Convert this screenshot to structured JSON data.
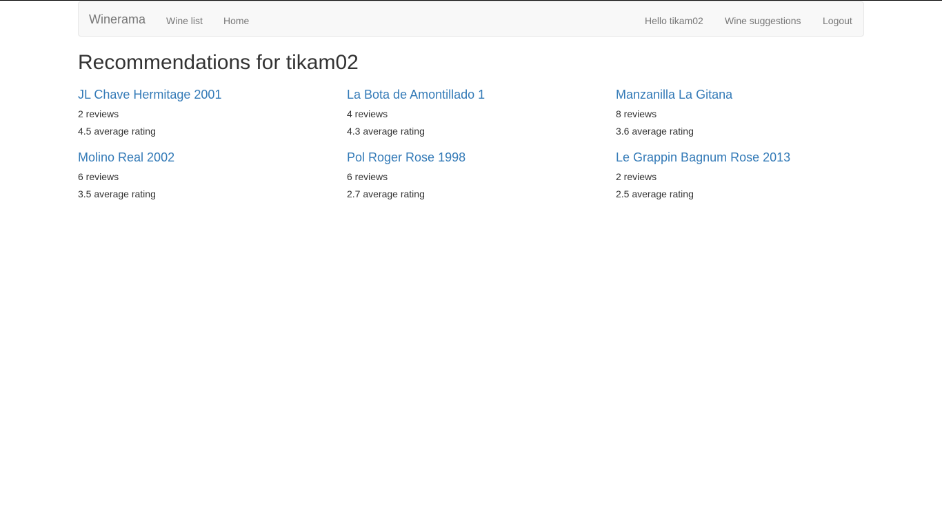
{
  "navbar": {
    "brand": "Winerama",
    "left_links": [
      "Wine list",
      "Home"
    ],
    "right_links": [
      "Hello tikam02",
      "Wine suggestions",
      "Logout"
    ]
  },
  "page": {
    "title": "Recommendations for tikam02"
  },
  "recommendations": [
    {
      "name": "JL Chave Hermitage 2001",
      "reviews": "2 reviews",
      "rating": "4.5 average rating"
    },
    {
      "name": "La Bota de Amontillado 1",
      "reviews": "4 reviews",
      "rating": "4.3 average rating"
    },
    {
      "name": "Manzanilla La Gitana",
      "reviews": "8 reviews",
      "rating": "3.6 average rating"
    },
    {
      "name": "Molino Real 2002",
      "reviews": "6 reviews",
      "rating": "3.5 average rating"
    },
    {
      "name": "Pol Roger Rose 1998",
      "reviews": "6 reviews",
      "rating": "2.7 average rating"
    },
    {
      "name": "Le Grappin Bagnum Rose 2013",
      "reviews": "2 reviews",
      "rating": "2.5 average rating"
    }
  ],
  "colors": {
    "link": "#337ab7",
    "navbar_bg": "#f8f8f8",
    "navbar_text": "#777777",
    "text": "#333333"
  }
}
